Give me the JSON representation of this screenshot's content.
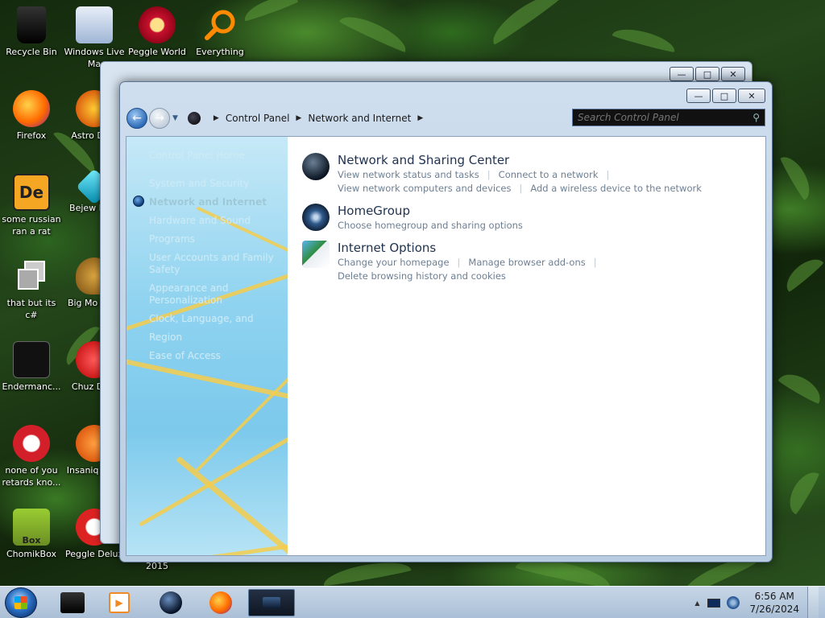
{
  "desktop": {
    "icons": [
      {
        "label": "Recycle Bin"
      },
      {
        "label": "Windows Live Ma"
      },
      {
        "label": "Peggle World"
      },
      {
        "label": "Everything"
      },
      {
        "label": "Firefox"
      },
      {
        "label": "Astro Delu"
      },
      {
        "label": "some russian ran a rat"
      },
      {
        "label": "Bejew Delu"
      },
      {
        "label": "that but its c#"
      },
      {
        "label": "Big Mo Delu"
      },
      {
        "label": "Endermanc..."
      },
      {
        "label": "Chuz Delu"
      },
      {
        "label": "none of you retards kno..."
      },
      {
        "label": "Insaniq Delu"
      },
      {
        "label": "ChomikBox"
      },
      {
        "label": "Peggle Delux"
      },
      {
        "label": "2015"
      }
    ]
  },
  "window": {
    "address": {
      "segments": [
        "Control Panel",
        "Network and Internet"
      ]
    },
    "search_placeholder": "Search Control Panel",
    "left_nav": {
      "items": [
        "Control Panel Home",
        "System and Security",
        "Network and Internet",
        "Hardware and Sound",
        "Programs",
        "User Accounts and Family Safety",
        "Appearance and Personalization",
        "Clock, Language, and Region",
        "Ease of Access"
      ],
      "current_index": 2
    },
    "categories": [
      {
        "title": "Network and Sharing Center",
        "links": [
          [
            "View network status and tasks",
            "Connect to a network"
          ],
          [
            "View network computers and devices",
            "Add a wireless device to the network"
          ]
        ]
      },
      {
        "title": "HomeGroup",
        "links": [
          [
            "Choose homegroup and sharing options"
          ]
        ]
      },
      {
        "title": "Internet Options",
        "links": [
          [
            "Change your homepage",
            "Manage browser add-ons",
            "Delete browsing history and cookies"
          ]
        ]
      }
    ]
  },
  "taskbar": {
    "clock_time": "6:56 AM",
    "clock_date": "7/26/2024"
  },
  "colors": {
    "accent": "#2d6cb8",
    "link": "#6d7f93",
    "title_text": "#1e3250"
  }
}
